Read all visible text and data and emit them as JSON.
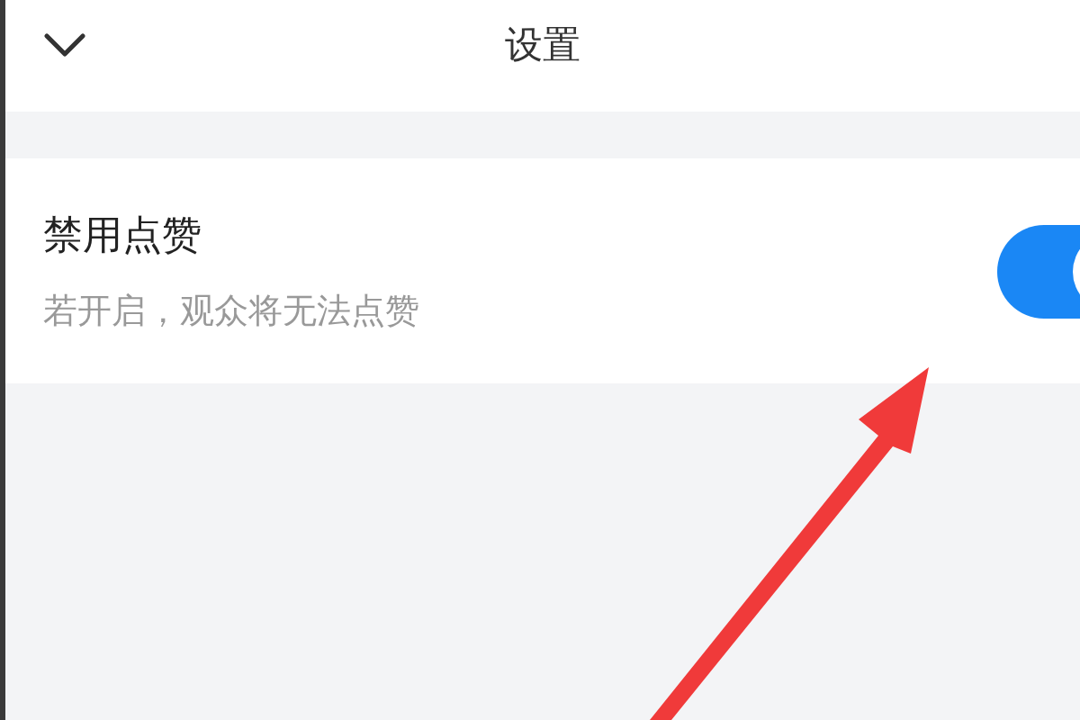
{
  "header": {
    "title": "设置"
  },
  "settings": [
    {
      "kind": "toggle",
      "label": "禁用点赞",
      "description": "若开启，观众将无法点赞",
      "on": true
    }
  ]
}
